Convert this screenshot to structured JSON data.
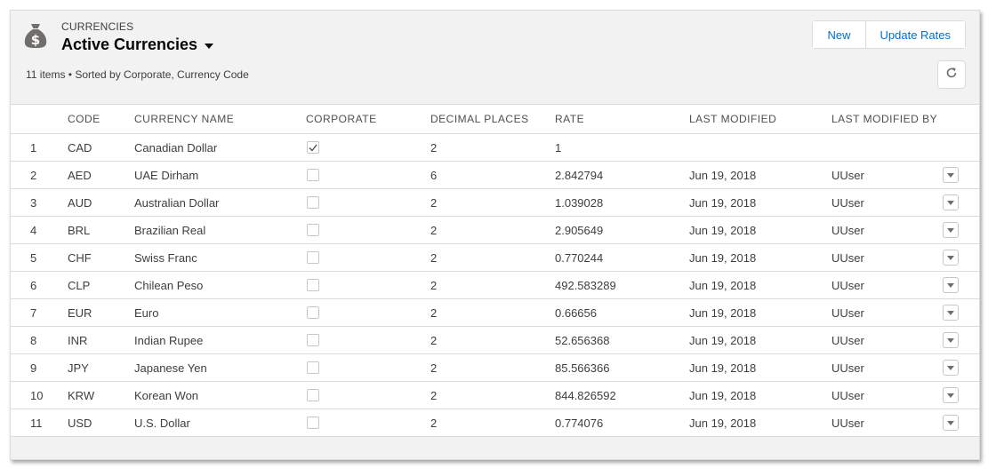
{
  "header": {
    "object_label": "CURRENCIES",
    "list_view_title": "Active Currencies",
    "meta": "11 items • Sorted by Corporate, Currency Code",
    "buttons": {
      "new_label": "New",
      "update_rates_label": "Update Rates"
    },
    "icons": {
      "object": "money-bag-icon",
      "refresh": "refresh-icon",
      "list_switcher": "caret-down-icon"
    }
  },
  "table": {
    "columns": {
      "code": "CODE",
      "name": "CURRENCY NAME",
      "corporate": "CORPORATE",
      "decimals": "DECIMAL PLACES",
      "rate": "RATE",
      "modified": "LAST MODIFIED",
      "modified_by": "LAST MODIFIED BY"
    },
    "rows": [
      {
        "num": "1",
        "code": "CAD",
        "name": "Canadian Dollar",
        "corporate": true,
        "decimals": "2",
        "rate": "1",
        "modified": "",
        "modified_by": "",
        "has_action": false
      },
      {
        "num": "2",
        "code": "AED",
        "name": "UAE Dirham",
        "corporate": false,
        "decimals": "6",
        "rate": "2.842794",
        "modified": "Jun 19, 2018",
        "modified_by": "UUser",
        "has_action": true
      },
      {
        "num": "3",
        "code": "AUD",
        "name": "Australian Dollar",
        "corporate": false,
        "decimals": "2",
        "rate": "1.039028",
        "modified": "Jun 19, 2018",
        "modified_by": "UUser",
        "has_action": true
      },
      {
        "num": "4",
        "code": "BRL",
        "name": "Brazilian Real",
        "corporate": false,
        "decimals": "2",
        "rate": "2.905649",
        "modified": "Jun 19, 2018",
        "modified_by": "UUser",
        "has_action": true
      },
      {
        "num": "5",
        "code": "CHF",
        "name": "Swiss Franc",
        "corporate": false,
        "decimals": "2",
        "rate": "0.770244",
        "modified": "Jun 19, 2018",
        "modified_by": "UUser",
        "has_action": true
      },
      {
        "num": "6",
        "code": "CLP",
        "name": "Chilean Peso",
        "corporate": false,
        "decimals": "2",
        "rate": "492.583289",
        "modified": "Jun 19, 2018",
        "modified_by": "UUser",
        "has_action": true
      },
      {
        "num": "7",
        "code": "EUR",
        "name": "Euro",
        "corporate": false,
        "decimals": "2",
        "rate": "0.66656",
        "modified": "Jun 19, 2018",
        "modified_by": "UUser",
        "has_action": true
      },
      {
        "num": "8",
        "code": "INR",
        "name": "Indian Rupee",
        "corporate": false,
        "decimals": "2",
        "rate": "52.656368",
        "modified": "Jun 19, 2018",
        "modified_by": "UUser",
        "has_action": true
      },
      {
        "num": "9",
        "code": "JPY",
        "name": "Japanese Yen",
        "corporate": false,
        "decimals": "2",
        "rate": "85.566366",
        "modified": "Jun 19, 2018",
        "modified_by": "UUser",
        "has_action": true
      },
      {
        "num": "10",
        "code": "KRW",
        "name": "Korean Won",
        "corporate": false,
        "decimals": "2",
        "rate": "844.826592",
        "modified": "Jun 19, 2018",
        "modified_by": "UUser",
        "has_action": true
      },
      {
        "num": "11",
        "code": "USD",
        "name": "U.S. Dollar",
        "corporate": false,
        "decimals": "2",
        "rate": "0.774076",
        "modified": "Jun 19, 2018",
        "modified_by": "UUser",
        "has_action": true
      }
    ]
  },
  "colors": {
    "link_blue": "#0070d2",
    "icon_gray": "#706e6b",
    "header_bg": "#f3f2f2",
    "border": "#dddbda"
  }
}
